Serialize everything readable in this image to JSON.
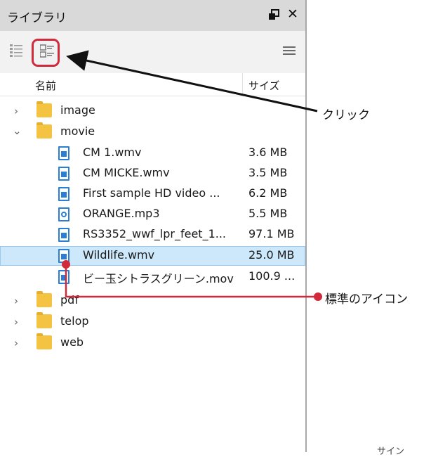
{
  "panel": {
    "title": "ライブラリ",
    "restore_icon": "restore-window-icon",
    "close_label": "✕"
  },
  "toolbar": {
    "list_view_icon": "list-view-icon",
    "icon_view_icon": "icon-view-icon",
    "menu_icon": "hamburger-menu-icon"
  },
  "columns": {
    "name": "名前",
    "size": "サイズ"
  },
  "tree": [
    {
      "type": "folder",
      "label": "image",
      "expanded": false
    },
    {
      "type": "folder",
      "label": "movie",
      "expanded": true
    },
    {
      "type": "file",
      "label": "CM 1.wmv",
      "size": "3.6 MB"
    },
    {
      "type": "file",
      "label": "CM MICKE.wmv",
      "size": "3.5 MB"
    },
    {
      "type": "file",
      "label": "First sample HD video ...",
      "size": "6.2 MB"
    },
    {
      "type": "audio",
      "label": "ORANGE.mp3",
      "size": "5.5 MB"
    },
    {
      "type": "file",
      "label": "RS3352_wwf_lpr_feet_1...",
      "size": "97.1 MB"
    },
    {
      "type": "file",
      "label": "Wildlife.wmv",
      "size": "25.0 MB",
      "selected": true
    },
    {
      "type": "file",
      "label": "ビー玉シトラスグリーン.mov",
      "size": "100.9 ..."
    },
    {
      "type": "folder",
      "label": "pdf",
      "expanded": false
    },
    {
      "type": "folder",
      "label": "telop",
      "expanded": false
    },
    {
      "type": "folder",
      "label": "web",
      "expanded": false
    }
  ],
  "annotations": {
    "click_label": "クリック",
    "standard_icon_label": "標準のアイコン",
    "accent_color": "#d12a3a",
    "bottom_partial": "サイン"
  }
}
